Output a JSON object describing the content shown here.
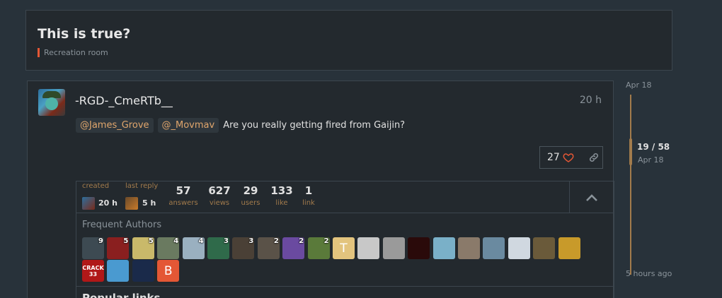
{
  "topic": {
    "title": "This is true?",
    "category": "Recreation room",
    "category_color": "#e45735"
  },
  "post": {
    "username": "-RGD-_CmeRTb__",
    "time": "20 h",
    "mentions": [
      "@James_Grove",
      "@_Movmav"
    ],
    "text": "Are you really getting fired from Gaijin?",
    "likes": "27",
    "like_icon": "heart-icon",
    "share_icon": "link-icon"
  },
  "topic_map": {
    "created_label": "created",
    "created_time": "20 h",
    "last_reply_label": "last reply",
    "last_reply_time": "5 h",
    "stats": [
      {
        "value": "57",
        "label": "answers"
      },
      {
        "value": "627",
        "label": "views"
      },
      {
        "value": "29",
        "label": "users"
      },
      {
        "value": "133",
        "label": "like"
      },
      {
        "value": "1",
        "label": "link"
      }
    ],
    "toggle_icon": "chevron-up-icon",
    "frequent_authors_title": "Frequent Authors",
    "authors_row1": [
      {
        "count": "9",
        "bg": "#3d4a52"
      },
      {
        "count": "5",
        "bg": "#8a1f1f"
      },
      {
        "count": "5",
        "bg": "#c9b96a"
      },
      {
        "count": "4",
        "bg": "#6a7a60"
      },
      {
        "count": "4",
        "bg": "#9ab0c0"
      },
      {
        "count": "3",
        "bg": "#2f6a4a"
      },
      {
        "count": "3",
        "bg": "#4a4036"
      },
      {
        "count": "2",
        "bg": "#5a5248"
      },
      {
        "count": "2",
        "bg": "#6a4aa0"
      },
      {
        "count": "2",
        "bg": "#5a7a3a"
      },
      {
        "count": "",
        "bg": "#e3c47e",
        "letter": "T"
      },
      {
        "count": "",
        "bg": "#c8c8c8"
      },
      {
        "count": "",
        "bg": "#9a9a9a"
      },
      {
        "count": "",
        "bg": "#2a0a0a"
      },
      {
        "count": "",
        "bg": "#7ab0c8"
      },
      {
        "count": "",
        "bg": "#8a7a6a"
      },
      {
        "count": "",
        "bg": "#6a8aa0"
      },
      {
        "count": "",
        "bg": "#d0d8e0"
      },
      {
        "count": "",
        "bg": "#6a5a3a"
      },
      {
        "count": "",
        "bg": "#c89a2a"
      }
    ],
    "authors_row2": [
      {
        "count": "",
        "bg": "#b01818",
        "text": "CRACK 33"
      },
      {
        "count": "",
        "bg": "#4a9ad0"
      },
      {
        "count": "",
        "bg": "#1a2a4a"
      },
      {
        "count": "",
        "bg": "#e45735",
        "letter": "B"
      }
    ],
    "popular_links_title": "Popular links"
  },
  "timeline": {
    "start": "Apr 18",
    "position": "19 / 58",
    "position_date": "Apr 18",
    "end": "5 hours ago"
  }
}
